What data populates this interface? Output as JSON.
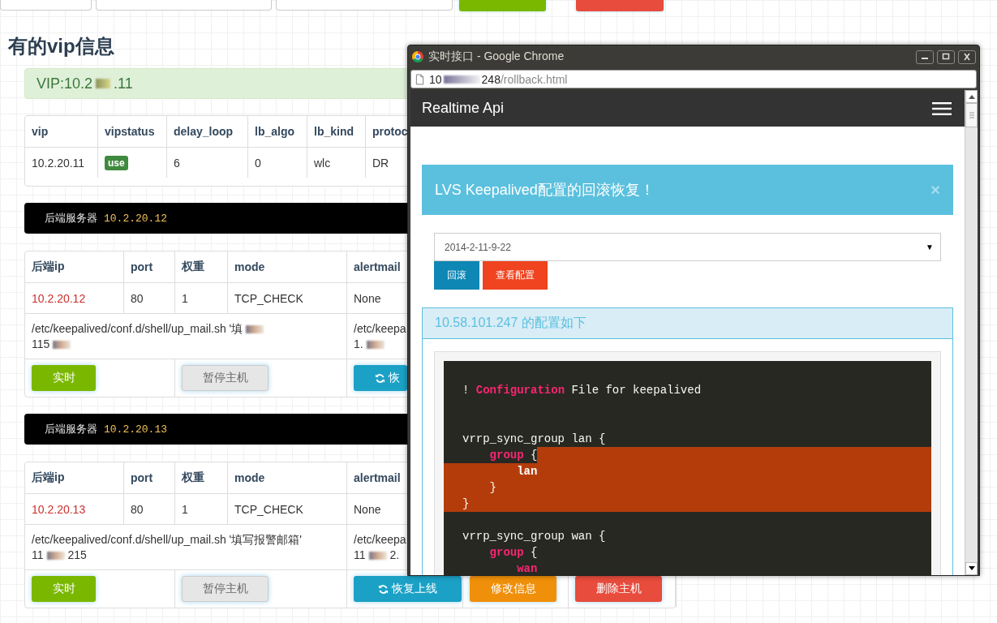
{
  "heading": "有的vip信息",
  "vip_alert": {
    "prefix": "VIP:10.2",
    "suffix": ".11"
  },
  "vip_table": {
    "columns": [
      "vip",
      "vipstatus",
      "delay_loop",
      "lb_algo",
      "lb_kind",
      "protoc"
    ],
    "rows": [
      [
        {
          "kind": "text",
          "text": "10.2.20.11"
        },
        {
          "kind": "badge",
          "text": "use"
        },
        {
          "kind": "text",
          "text": "6"
        },
        {
          "kind": "text",
          "text": "0"
        },
        {
          "kind": "text",
          "text": "wlc"
        },
        {
          "kind": "text",
          "text": "DR"
        }
      ]
    ]
  },
  "backends": [
    {
      "label": "后端服务器",
      "ip": "10.2.20.12",
      "columns": [
        "后端ip",
        "port",
        "权重",
        "mode",
        "alertmail"
      ],
      "row": [
        {
          "kind": "ip",
          "text": "10.2.20.12"
        },
        {
          "kind": "text",
          "text": "80"
        },
        {
          "kind": "text",
          "text": "1"
        },
        {
          "kind": "text",
          "text": "TCP_CHECK"
        },
        {
          "kind": "text",
          "text": "None"
        }
      ],
      "commands": [
        [
          [
            {
              "kind": "text",
              "text": "/etc/keepalived/conf.d/shell/up_mail.sh '填"
            },
            {
              "kind": "redacted"
            }
          ],
          [
            {
              "kind": "text",
              "text": "115"
            },
            {
              "kind": "redacted"
            }
          ]
        ],
        [
          [
            {
              "kind": "text",
              "text": "/etc/keepa"
            }
          ],
          [
            {
              "kind": "text",
              "text": "1."
            },
            {
              "kind": "redacted"
            }
          ]
        ]
      ],
      "buttons": [
        {
          "kind": "live",
          "label": "实时"
        },
        {
          "kind": "pause",
          "label": "暂停主机"
        },
        {
          "kind": "restore",
          "label": "恢"
        }
      ]
    },
    {
      "label": "后端服务器",
      "ip": "10.2.20.13",
      "columns": [
        "后端ip",
        "port",
        "权重",
        "mode",
        "alertmail"
      ],
      "row": [
        {
          "kind": "ip",
          "text": "10.2.20.13"
        },
        {
          "kind": "text",
          "text": "80"
        },
        {
          "kind": "text",
          "text": "1"
        },
        {
          "kind": "text",
          "text": "TCP_CHECK"
        },
        {
          "kind": "text",
          "text": "None"
        }
      ],
      "commands": [
        [
          [
            {
              "kind": "text",
              "text": "/etc/keepalived/conf.d/shell/up_mail.sh '填写报警邮箱'"
            }
          ],
          [
            {
              "kind": "text",
              "text": "11"
            },
            {
              "kind": "redacted"
            },
            {
              "kind": "text",
              "text": "215"
            }
          ]
        ],
        [
          [
            {
              "kind": "text",
              "text": "/etc/keepa"
            }
          ],
          [
            {
              "kind": "text",
              "text": "11"
            },
            {
              "kind": "redacted"
            },
            {
              "kind": "text",
              "text": "2."
            }
          ]
        ]
      ],
      "buttons": [
        {
          "kind": "live",
          "label": "实时"
        },
        {
          "kind": "pause",
          "label": "暂停主机"
        },
        {
          "kind": "restore",
          "label": "恢复上线"
        },
        {
          "kind": "edit",
          "label": "修改信息"
        },
        {
          "kind": "delete",
          "label": "删除主机"
        }
      ]
    }
  ],
  "popup": {
    "title": "实时接口 - Google Chrome",
    "url": {
      "host_start": "10",
      "host_end": "248",
      "path": "/rollback.html"
    },
    "brand": "Realtime Api",
    "alert": {
      "text": "LVS Keepalived配置的回滚恢复！",
      "close": "×"
    },
    "select": {
      "value": "2014-2-11-9-22",
      "arrow": "▼"
    },
    "buttons": [
      {
        "kind": "primary",
        "label": "回滚"
      },
      {
        "kind": "danger",
        "label": "查看配置"
      }
    ],
    "panel": {
      "heading": "10.58.101.247 的配置如下",
      "code": [
        {
          "kind": "code",
          "selected": false,
          "segments": [
            {
              "kind": "plain",
              "text": "! "
            },
            {
              "kind": "keyword",
              "text": "Configuration"
            },
            {
              "kind": "plain",
              "text": " File for keepalived"
            }
          ]
        },
        {
          "kind": "blank"
        },
        {
          "kind": "blank"
        },
        {
          "kind": "code",
          "selected": false,
          "segments": [
            {
              "kind": "plain",
              "text": "vrrp_sync_group lan {"
            }
          ]
        },
        {
          "kind": "code",
          "selected": true,
          "segments": [
            {
              "kind": "keyword",
              "text": "    group"
            },
            {
              "kind": "plain",
              "text": " {"
            }
          ]
        },
        {
          "kind": "code",
          "selected": true,
          "segments": [
            {
              "kind": "bold",
              "text": "        lan"
            }
          ]
        },
        {
          "kind": "code",
          "selected": true,
          "segments": [
            {
              "kind": "plain",
              "text": "    }"
            }
          ]
        },
        {
          "kind": "code",
          "selected": true,
          "segments": [
            {
              "kind": "plain",
              "text": "}"
            }
          ]
        },
        {
          "kind": "blank"
        },
        {
          "kind": "code",
          "selected": false,
          "segments": [
            {
              "kind": "plain",
              "text": "vrrp_sync_group wan {"
            }
          ]
        },
        {
          "kind": "code",
          "selected": false,
          "segments": [
            {
              "kind": "keyword",
              "text": "    group"
            },
            {
              "kind": "plain",
              "text": " {"
            }
          ]
        },
        {
          "kind": "code",
          "selected": false,
          "segments": [
            {
              "kind": "keyword",
              "text": "        wan"
            }
          ]
        }
      ]
    }
  }
}
